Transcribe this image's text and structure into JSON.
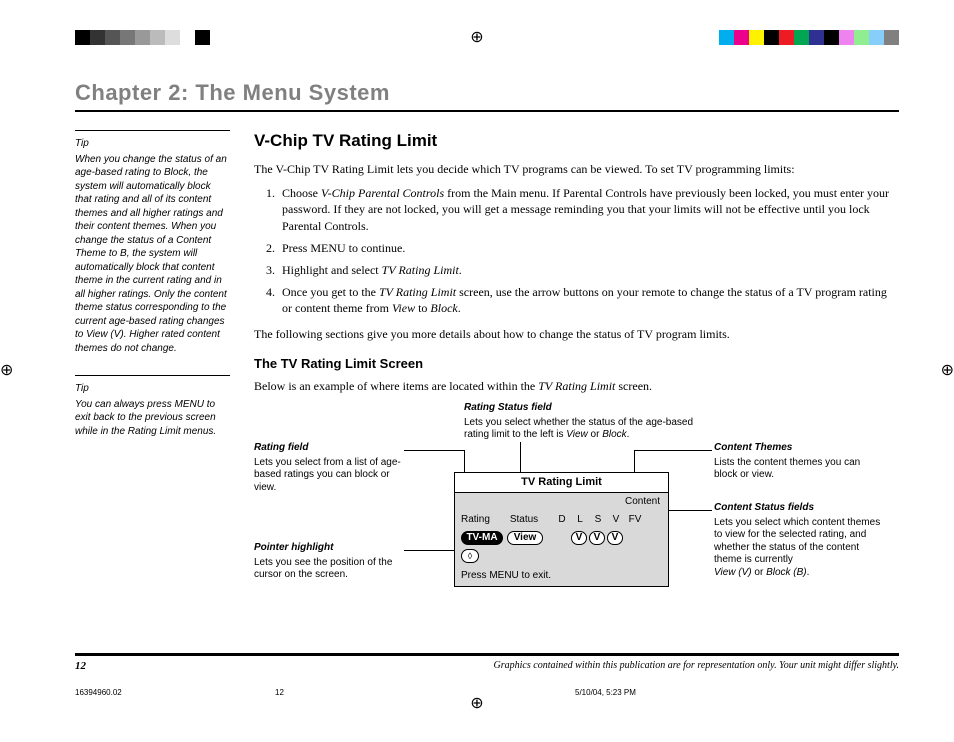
{
  "chapter_title": "Chapter 2: The Menu System",
  "sidebar": {
    "tip1_head": "Tip",
    "tip1": "When you change the status of an age-based rating to Block, the system will automatically block that rating and all of its content themes and all higher ratings and their content themes. When you change the status of a Content Theme to B, the system will automatically block that content theme in the current rating and in all higher ratings. Only the content theme status corresponding to the current age-based rating changes to View (V). Higher rated content themes do not change.",
    "tip2_head": "Tip",
    "tip2": "You can always press MENU to exit back to the previous screen while in the Rating Limit menus."
  },
  "main": {
    "h2": "V-Chip TV Rating Limit",
    "intro": "The V-Chip TV Rating Limit lets you decide which TV programs can be viewed. To set TV programming limits:",
    "steps": [
      {
        "pre": "Choose ",
        "em": "V-Chip Parental Controls",
        "post": " from the Main menu. If Parental Controls have previously been locked, you must enter your password. If they are not locked, you will get a message reminding you that your limits will not be effective until you lock Parental Controls."
      },
      {
        "pre": "Press MENU to continue.",
        "em": "",
        "post": ""
      },
      {
        "pre": "Highlight and select ",
        "em": "TV Rating Limit",
        "post": "."
      },
      {
        "pre": "Once you get to the ",
        "em": "TV Rating Limit",
        "post": " screen, use the arrow buttons on your remote to change the status of a TV program rating or content theme from ",
        "em2": "View",
        "mid": " to ",
        "em3": "Block",
        "end": "."
      }
    ],
    "after_steps": "The following sections give you more details about how to change the status of TV program limits.",
    "h3": "The TV Rating Limit Screen",
    "below_pre": "Below is an example of where items are located within the ",
    "below_em": "TV Rating Limit",
    "below_post": " screen."
  },
  "labels": {
    "rating_status_title": "Rating Status field",
    "rating_status_desc_pre": "Lets you select whether the status of the age-based rating limit to the left is ",
    "rating_status_em1": "View",
    "rating_status_mid": " or ",
    "rating_status_em2": "Block",
    "rating_status_end": ".",
    "rating_field_title": "Rating field",
    "rating_field_desc": "Lets you select from a list of age-based ratings you can block or view.",
    "pointer_title": "Pointer highlight",
    "pointer_desc": "Lets you see the position of the cursor on the screen.",
    "content_themes_title": "Content Themes",
    "content_themes_desc": "Lists the content themes you can block or view.",
    "content_status_title": "Content Status fields",
    "content_status_desc_pre": "Lets you select which content themes to view for the selected rating, and whether the status of the content theme is currently",
    "content_status_em1": "View (V)",
    "content_status_mid": " or ",
    "content_status_em2": "Block (B)",
    "content_status_end": "."
  },
  "screen": {
    "title": "TV Rating Limit",
    "col_rating": "Rating",
    "col_status": "Status",
    "col_content": "Content",
    "c_d": "D",
    "c_l": "L",
    "c_s": "S",
    "c_v": "V",
    "c_fv": "FV",
    "row_rating": "TV-MA",
    "row_status": "View",
    "v1": "V",
    "v2": "V",
    "v3": "V",
    "pointer": "◊",
    "footer": "Press MENU to exit."
  },
  "footer": {
    "page": "12",
    "disclaimer": "Graphics contained within this publication are for representation only. Your unit might differ slightly."
  },
  "job": {
    "file": "16394960.02",
    "page": "12",
    "stamp": "5/10/04, 5:23 PM"
  },
  "colors_left": [
    "#000",
    "#333",
    "#555",
    "#777",
    "#999",
    "#bbb",
    "#ddd",
    "#fff",
    "#000",
    "#fff"
  ],
  "colors_right": [
    "#00aeef",
    "#ec008c",
    "#fff200",
    "#000",
    "#ed1c24",
    "#00a651",
    "#2e3192",
    "#000",
    "#ee82ee",
    "#90ee90",
    "#87cefa",
    "#808080"
  ]
}
